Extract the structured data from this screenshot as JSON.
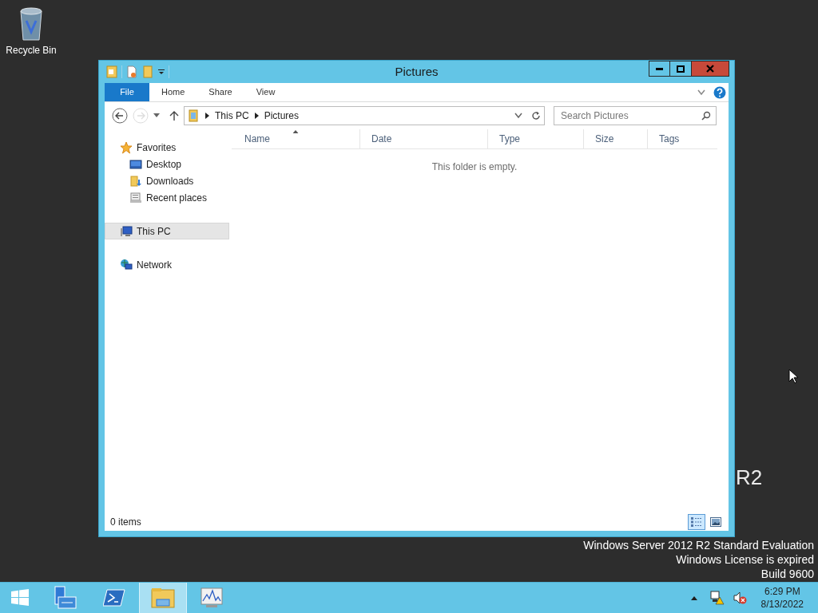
{
  "desktop_icons": [
    {
      "label": "Recycle Bin"
    }
  ],
  "window": {
    "title": "Pictures"
  },
  "ribbon_tabs": [
    {
      "label": "File",
      "selected": true
    },
    {
      "label": "Home",
      "selected": false
    },
    {
      "label": "Share",
      "selected": false
    },
    {
      "label": "View",
      "selected": false
    }
  ],
  "address_bar": {
    "crumbs": [
      "This PC",
      "Pictures"
    ]
  },
  "search": {
    "placeholder": "Search Pictures"
  },
  "columns": [
    {
      "label": "Name",
      "sorted": true
    },
    {
      "label": "Date",
      "sorted": false
    },
    {
      "label": "Type",
      "sorted": false
    },
    {
      "label": "Size",
      "sorted": false
    },
    {
      "label": "Tags",
      "sorted": false
    }
  ],
  "sidebar": {
    "items": [
      {
        "label": "Favorites",
        "kind": "star",
        "selected": false,
        "children": [
          {
            "label": "Desktop",
            "kind": "desktop",
            "selected": false
          },
          {
            "label": "Downloads",
            "kind": "downloads",
            "selected": false
          },
          {
            "label": "Recent places",
            "kind": "recent",
            "selected": false
          }
        ]
      },
      {
        "label": "This PC",
        "kind": "pc",
        "selected": true
      },
      {
        "label": "Network",
        "kind": "network",
        "selected": false
      }
    ]
  },
  "empty_message": "This folder is empty.",
  "status_bar": {
    "text": "0 items",
    "views": [
      {
        "kind": "details",
        "selected": true
      },
      {
        "kind": "thumbnails",
        "selected": false
      }
    ]
  },
  "watermark": {
    "fragment": "R2",
    "lines": [
      "Windows Server 2012 R2 Standard Evaluation",
      "Windows License is expired",
      "Build 9600"
    ]
  },
  "taskbar": {
    "items": [
      {
        "kind": "start",
        "selected": false
      },
      {
        "kind": "server-manager",
        "selected": false
      },
      {
        "kind": "powershell",
        "selected": false
      },
      {
        "kind": "explorer",
        "selected": true
      },
      {
        "kind": "monitor",
        "selected": false
      }
    ],
    "time": "6:29 PM",
    "date": "8/13/2022"
  }
}
